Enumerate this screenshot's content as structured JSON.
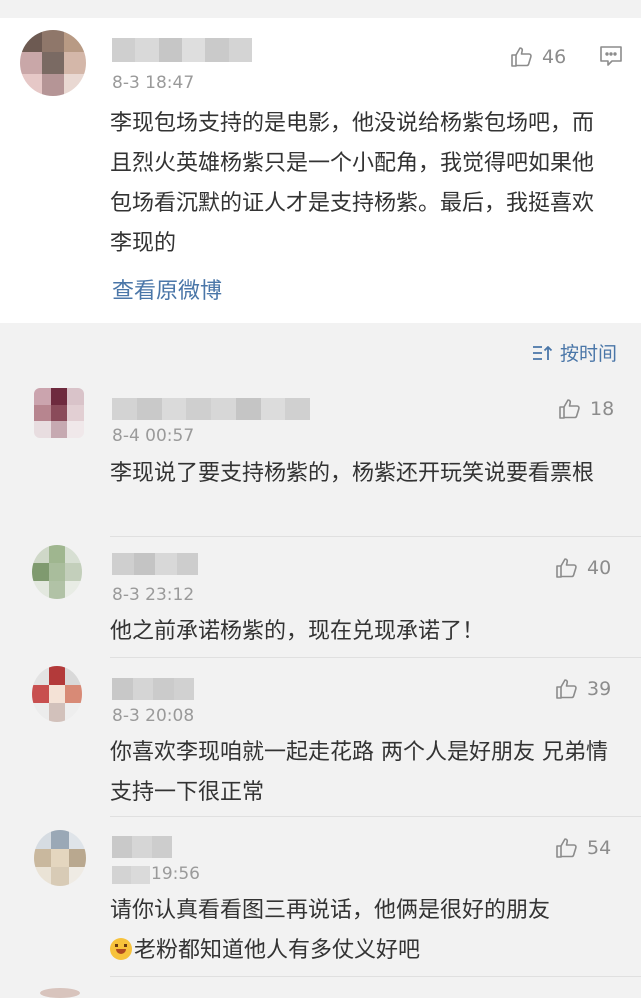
{
  "main_post": {
    "timestamp": "8-3 18:47",
    "likes": "46",
    "text": "李现包场支持的是电影，他没说给杨紫包场吧，而且烈火英雄杨紫只是一个小配角，我觉得吧如果他包场看沉默的证人才是支持杨紫。最后，我挺喜欢李现的",
    "view_original": "查看原微博"
  },
  "sort_label": "按时间",
  "comments": [
    {
      "timestamp": "8-4 00:57",
      "likes": "18",
      "text": "李现说了要支持杨紫的，杨紫还开玩笑说要看票根"
    },
    {
      "timestamp": "8-3 23:12",
      "likes": "40",
      "text": "他之前承诺杨紫的，现在兑现承诺了！"
    },
    {
      "timestamp": "8-3 20:08",
      "likes": "39",
      "text": "你喜欢李现咱就一起走花路 两个人是好朋友 兄弟情 支持一下很正常"
    },
    {
      "timestamp": "19:56",
      "likes": "54",
      "text": "请你认真看看图三再说话，他俩是很好的朋友",
      "text_line2": "老粉都知道他人有多仗义好吧"
    }
  ],
  "icons": {
    "like": "thumbs-up-icon",
    "comment": "comment-icon",
    "sort": "sort-icon",
    "emoji": "crying-emoji-icon"
  },
  "colors": {
    "link": "#4a76a8",
    "meta": "#9a9a9a",
    "text": "#333333"
  }
}
